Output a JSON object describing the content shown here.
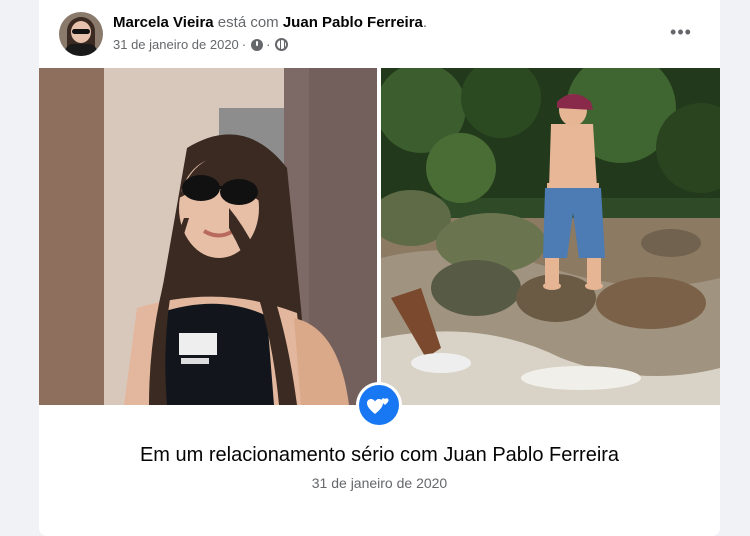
{
  "post": {
    "author": "Marcela Vieira",
    "connector": " está com ",
    "tagged": "Juan Pablo Ferreira",
    "tagged_suffix": ".",
    "date": "31 de janeiro de 2020",
    "separator": "·",
    "privacy_icon": "globe-icon",
    "time_icon": "clock-icon",
    "more_label": "•••"
  },
  "photos": {
    "left_photo": "woman-selfie-sunglasses",
    "right_photo": "man-standing-on-river-rocks"
  },
  "life_event": {
    "icon": "hearts-icon",
    "title": "Em um relacionamento sério com Juan Pablo Ferreira",
    "date": "31 de janeiro de 2020"
  },
  "colors": {
    "accent": "#1877f2",
    "background": "#f0f2f5",
    "text_primary": "#050505",
    "text_secondary": "#65676b"
  }
}
